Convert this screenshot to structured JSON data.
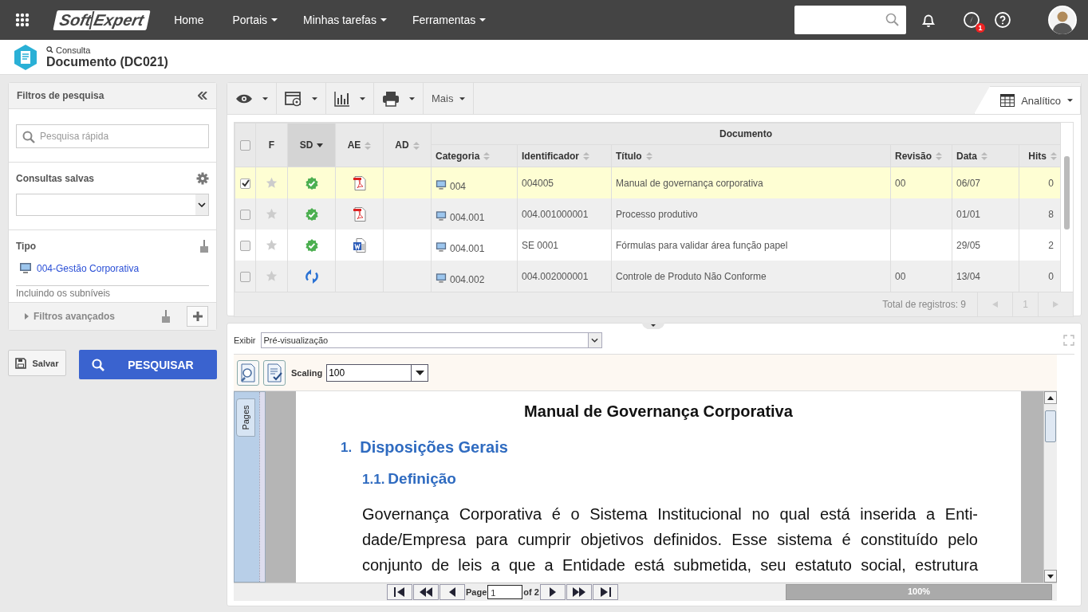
{
  "topbar": {
    "logo": {
      "first": "Soft",
      "second": "Expert"
    },
    "nav": [
      {
        "label": "Home",
        "dropdown": false
      },
      {
        "label": "Portais",
        "dropdown": true
      },
      {
        "label": "Minhas tarefas",
        "dropdown": true
      },
      {
        "label": "Ferramentas",
        "dropdown": true
      }
    ],
    "notification_count": "1"
  },
  "header": {
    "breadcrumb": "Consulta",
    "title": "Documento (DC021)"
  },
  "filters": {
    "title": "Filtros de pesquisa",
    "quick_search": {
      "placeholder": "Pesquisa rápida"
    },
    "saved_label": "Consultas salvas",
    "type_label": "Tipo",
    "type_value": "004-Gestão Corporativa",
    "type_note": "Incluindo os subníveis",
    "advanced": "Filtros avançados",
    "save_button": "Salvar",
    "search_button": "PESQUISAR"
  },
  "toolbar": {
    "more": "Mais",
    "view": "Analítico"
  },
  "table": {
    "header_checked": false,
    "group": "Documento",
    "columns": [
      {
        "label": "F",
        "sortable": false,
        "sorted": false
      },
      {
        "label": "SD",
        "sortable": true,
        "sorted": true
      },
      {
        "label": "AE",
        "sortable": true,
        "sorted": false
      },
      {
        "label": "AD",
        "sortable": true,
        "sorted": false
      },
      {
        "label": "Categoria",
        "sortable": true,
        "sorted": false
      },
      {
        "label": "Identificador",
        "sortable": true,
        "sorted": false
      },
      {
        "label": "Título",
        "sortable": true,
        "sorted": false
      },
      {
        "label": "Revisão",
        "sortable": true,
        "sorted": false
      },
      {
        "label": "Data",
        "sortable": true,
        "sorted": false
      },
      {
        "label": "Hits",
        "sortable": true,
        "sorted": false
      }
    ],
    "rows": [
      {
        "selected": true,
        "favorite": false,
        "status": {
          "kind": "approved"
        },
        "file": {
          "kind": "pdf"
        },
        "category": "004",
        "id": "004005",
        "title": "Manual de governança corporativa",
        "revision": "00",
        "date": "06/07",
        "hits": "0"
      },
      {
        "selected": false,
        "favorite": false,
        "status": {
          "kind": "approved"
        },
        "file": {
          "kind": "pdf"
        },
        "category": "004.001",
        "id": "004.001000001",
        "title": "Processo produtivo",
        "revision": "",
        "date": "01/01",
        "hits": "8"
      },
      {
        "selected": false,
        "favorite": false,
        "status": {
          "kind": "approved"
        },
        "file": {
          "kind": "word"
        },
        "category": "004.001",
        "id": "SE 0001",
        "title": "Fórmulas para validar área função papel",
        "revision": "",
        "date": "29/05",
        "hits": "2"
      },
      {
        "selected": false,
        "favorite": false,
        "status": {
          "kind": "revision"
        },
        "category": "004.002",
        "id": "004.002000001",
        "title": "Controle de Produto Não Conforme",
        "revision": "00",
        "date": "13/04",
        "hits": "0"
      }
    ],
    "total": "Total de registros: 9",
    "page": "1"
  },
  "preview": {
    "show_label": "Exibir",
    "show_value": "Pré-visualização",
    "scaling_label": "Scaling",
    "scaling_value": "100",
    "pages_tab": "Pages",
    "document": {
      "title": "Manual de Governança Corporativa",
      "h1_number": "1.",
      "h1": "Disposições Gerais",
      "h2_number": "1.1.",
      "h2": "Definição",
      "lines": [
        "Governança Corporativa é o Sistema Institucional no qual está inserida a Enti-",
        "dade/Empresa para cumprir objetivos definidos. Esse sistema é constituído pelo",
        "conjunto de leis a que a Entidade está submetida, seu estatuto social, estrutura"
      ]
    },
    "page_label": "Page",
    "page_value": "1",
    "page_total": "of 2",
    "progress": {
      "level": 1,
      "reading": "100%"
    }
  }
}
